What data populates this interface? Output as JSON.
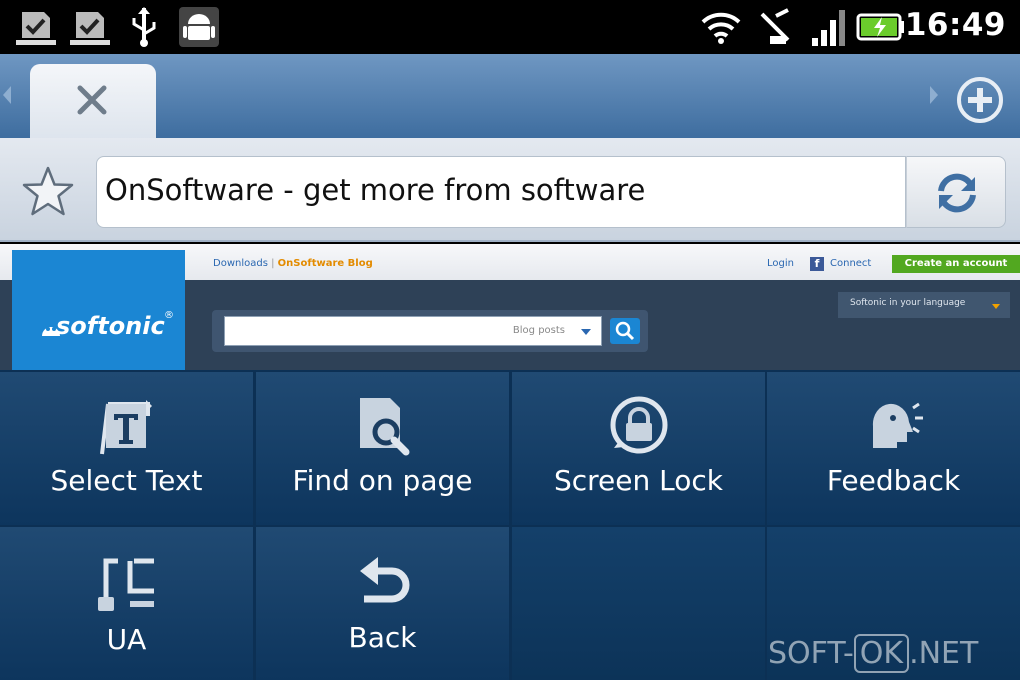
{
  "status_bar": {
    "time": "16:49",
    "icons": [
      "download-done-icon",
      "download-done-icon",
      "usb-icon",
      "android-debug-icon",
      "wifi-icon",
      "no-signal-icon",
      "signal-bars-icon",
      "battery-charging-icon"
    ]
  },
  "browser": {
    "tab_close_icon": "close-icon",
    "new_tab_icon": "add-circle-icon",
    "bookmark_icon": "star-icon",
    "url_title": "OnSoftware - get more from software",
    "reload_icon": "refresh-icon"
  },
  "webpage": {
    "logo_text": "softonic",
    "logo_reg": "®",
    "links": {
      "downloads": "Downloads",
      "separator": "|",
      "blog": "OnSoftware Blog"
    },
    "login": "Login",
    "facebook_letter": "f",
    "connect": "Connect",
    "create_account": "Create an account",
    "search_placeholder": "Blog posts",
    "language_label": "Softonic in your language",
    "accent_blue": "#1b86d3",
    "create_green": "#52a820"
  },
  "menu": {
    "items": [
      {
        "label": "Select Text",
        "icon": "select-text-icon"
      },
      {
        "label": "Find on page",
        "icon": "find-on-page-icon"
      },
      {
        "label": "Screen Lock",
        "icon": "screen-lock-icon"
      },
      {
        "label": "Feedback",
        "icon": "feedback-icon"
      },
      {
        "label": "UA",
        "icon": "user-agent-icon"
      },
      {
        "label": "Back",
        "icon": "back-arrow-icon"
      }
    ]
  },
  "watermark": {
    "prefix": "SOFT-",
    "boxed": "OK",
    "suffix": ".NET"
  }
}
